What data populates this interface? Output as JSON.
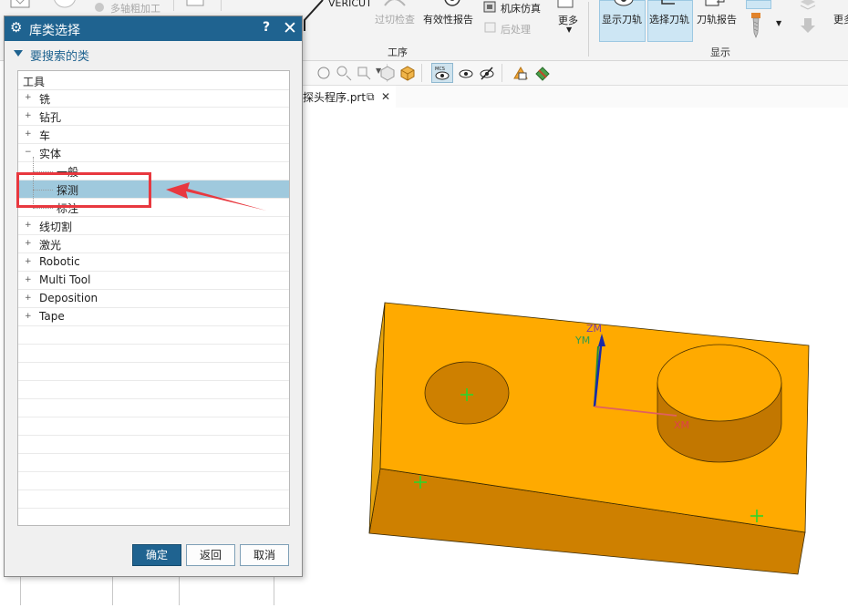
{
  "ribbon": {
    "buttons": {
      "multi_axis_rough": "多轴粗加工",
      "vericut": "VERICUT",
      "overcut_check": "过切检查",
      "validity_report": "有效性报告",
      "machine_simulation": "机床仿真",
      "post_process": "后处理",
      "more": "更多",
      "show_toolpath": "显示刀轨",
      "select_toolpath": "选择刀轨",
      "toolpath_report": "刀轨报告",
      "more_right": "更多"
    },
    "groups": {
      "operation": "工序",
      "display": "显示"
    }
  },
  "tab": {
    "label": "探头程序.prt",
    "restore_icon": "restore-icon",
    "close_icon": "close-icon"
  },
  "viewport": {
    "coords": {
      "z": "ZM",
      "y": "YM",
      "x": "XM"
    },
    "colors": {
      "block_top": "#FFAA00",
      "block_front": "#CE8000",
      "z_axis": "#1a2aa8",
      "y_axis": "#1e8a3a",
      "x_axis": "#e06060",
      "marker": "#2bd62b"
    }
  },
  "dialog": {
    "title": "库类选择",
    "help": "?",
    "close": "✕",
    "section_title": "要搜索的类",
    "tree_header": "工具",
    "items": [
      {
        "label": "铣",
        "expander": "+"
      },
      {
        "label": "钻孔",
        "expander": "+"
      },
      {
        "label": "车",
        "expander": "+"
      },
      {
        "label": "实体",
        "expander": "−"
      },
      {
        "label": "一般",
        "expander": ""
      },
      {
        "label": "探测",
        "expander": ""
      },
      {
        "label": "标注",
        "expander": ""
      },
      {
        "label": "线切割",
        "expander": "+"
      },
      {
        "label": "激光",
        "expander": "+"
      },
      {
        "label": "Robotic",
        "expander": "+"
      },
      {
        "label": "Multi Tool",
        "expander": "+"
      },
      {
        "label": "Deposition",
        "expander": "+"
      },
      {
        "label": "Tape",
        "expander": "+"
      }
    ],
    "selected_item": "探测",
    "buttons": {
      "ok": "确定",
      "back": "返回",
      "cancel": "取消"
    }
  },
  "annotation": {
    "color": "#E8383F"
  }
}
